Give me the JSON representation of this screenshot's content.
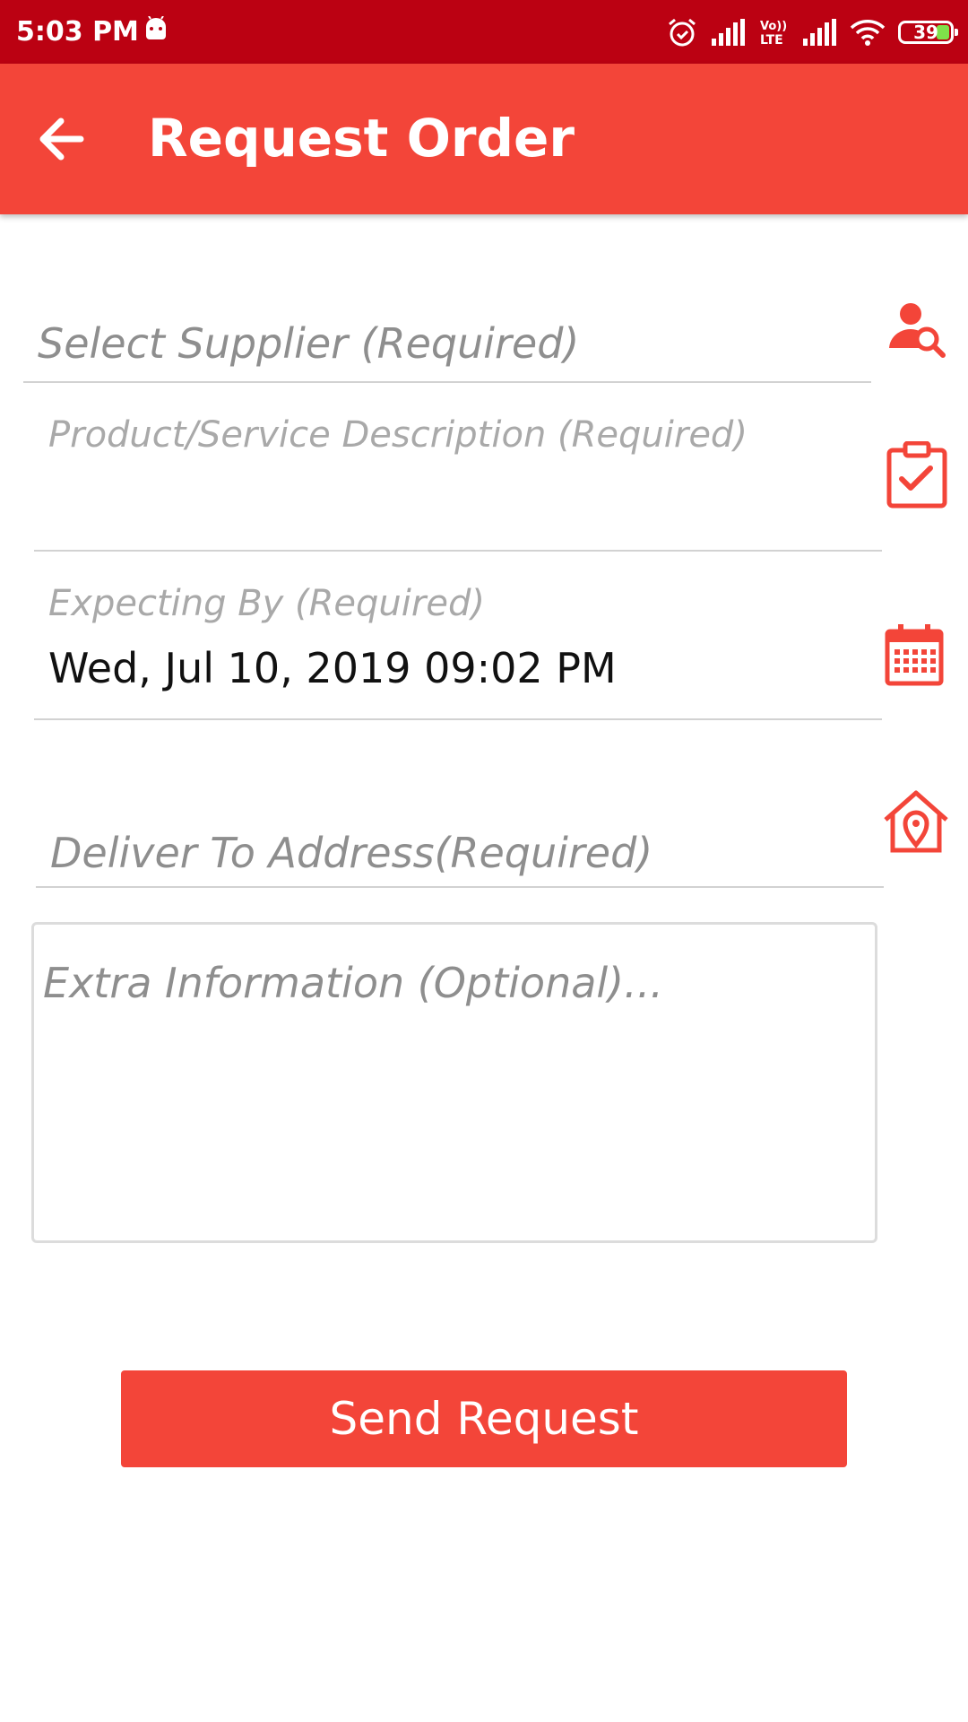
{
  "status_bar": {
    "time": "5:03 PM",
    "battery_level": "39",
    "icons": [
      "android-icon",
      "alarm-icon",
      "signal-icon",
      "volte-icon",
      "signal-icon",
      "wifi-icon",
      "battery-icon"
    ]
  },
  "app_bar": {
    "title": "Request Order",
    "back_icon": "arrow-left-icon"
  },
  "form": {
    "supplier": {
      "placeholder": "Select Supplier (Required)",
      "icon": "person-search-icon"
    },
    "description": {
      "placeholder": "Product/Service Description (Required)",
      "icon": "clipboard-check-icon"
    },
    "expecting_by": {
      "label": "Expecting By (Required)",
      "value": "Wed, Jul 10, 2019 09:02 PM",
      "icon": "calendar-icon"
    },
    "address": {
      "placeholder": "Deliver To Address(Required)",
      "icon": "home-location-icon"
    },
    "extra": {
      "placeholder": "Extra Information (Optional)..."
    }
  },
  "actions": {
    "send_label": "Send Request"
  },
  "colors": {
    "accent": "#f34539",
    "status_bar": "#bb0112"
  }
}
